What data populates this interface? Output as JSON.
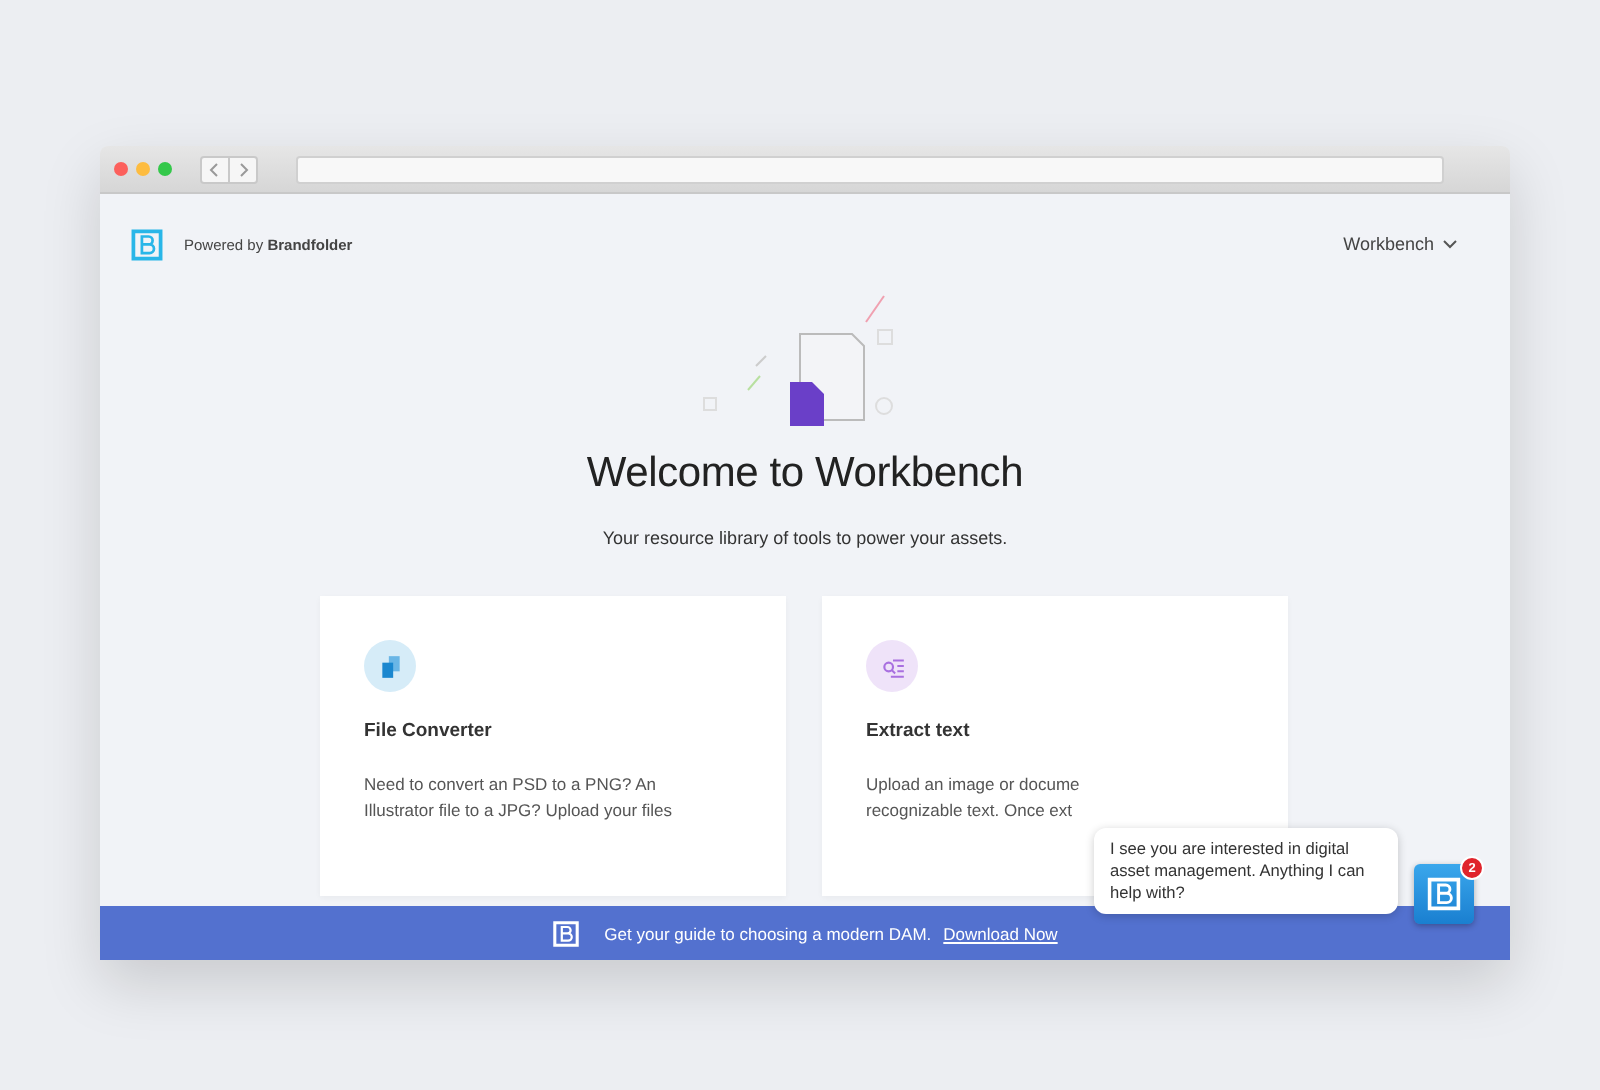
{
  "header": {
    "powered_by": "Powered by **Brandfolder**",
    "menu": "Workbench"
  },
  "hero": {
    "title": "Welcome to Workbench",
    "subtitle": "Your resource library of tools to power your assets."
  },
  "cards": [
    {
      "kind": "convert",
      "title": "File Converter",
      "lines": [
        "Need to convert an PSD to a PNG? An",
        "Illustrator file to a JPG? Upload your files"
      ]
    },
    {
      "kind": "extract",
      "title": "Extract text",
      "lines": [
        "Upload an image or docume",
        "recognizable text. Once ext"
      ]
    }
  ],
  "banner": {
    "text": "Get your guide to choosing a modern DAM.",
    "link": "Download Now"
  },
  "chat": {
    "message": "I see you are interested in digital asset management. Anything I can help with?",
    "badge": "2"
  }
}
